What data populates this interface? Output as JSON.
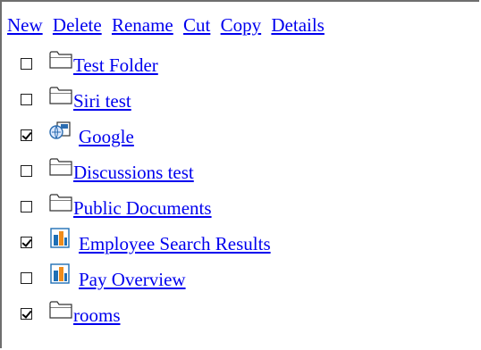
{
  "toolbar": {
    "new_label": "New",
    "delete_label": "Delete",
    "rename_label": "Rename",
    "cut_label": "Cut",
    "copy_label": "Copy",
    "details_label": "Details"
  },
  "items": [
    {
      "label": "Test Folder",
      "icon": "folder-icon",
      "checked": false
    },
    {
      "label": "Siri test",
      "icon": "folder-icon",
      "checked": false
    },
    {
      "label": "Google",
      "icon": "link-document-icon",
      "checked": true
    },
    {
      "label": "Discussions test",
      "icon": "folder-icon",
      "checked": false
    },
    {
      "label": "Public Documents",
      "icon": "folder-icon",
      "checked": false
    },
    {
      "label": "Employee Search Results",
      "icon": "report-icon",
      "checked": true
    },
    {
      "label": "Pay Overview",
      "icon": "report-icon",
      "checked": false
    },
    {
      "label": "rooms",
      "icon": "folder-icon",
      "checked": true
    }
  ],
  "colors": {
    "link": "#0000ee",
    "border": "#6e6e6e",
    "report_blue": "#1f6fb5",
    "report_orange": "#f08c1a",
    "folder_outline": "#333333"
  }
}
